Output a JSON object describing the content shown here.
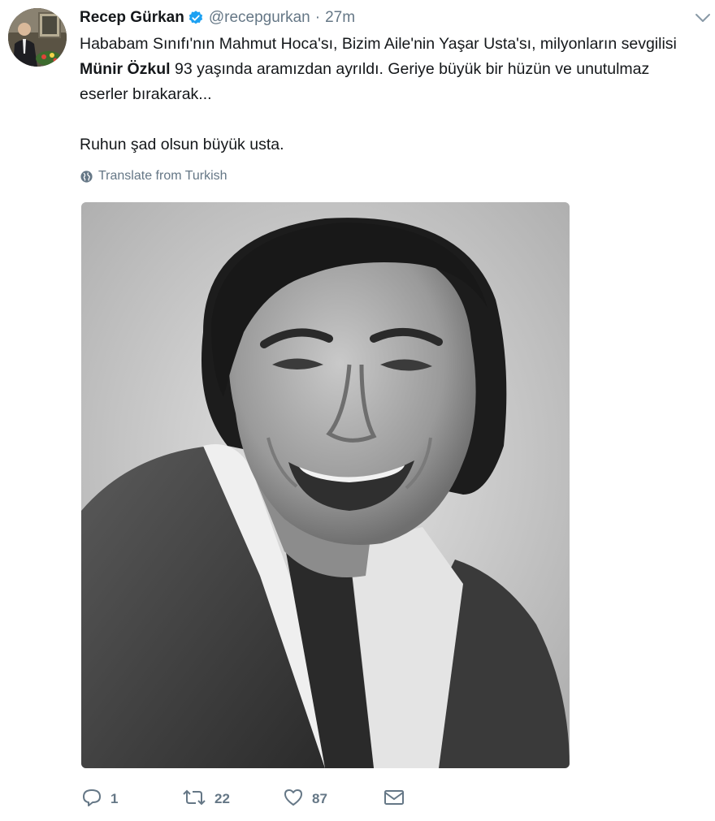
{
  "tweet": {
    "author": {
      "name": "Recep Gürkan",
      "handle": "@recepgurkan",
      "avatar_icon": "profile-photo",
      "verified_icon": "verified-badge-icon"
    },
    "separator": "·",
    "time": "27m",
    "text": {
      "p1_part1": "Hababam Sınıfı'nın Mahmut Hoca'sı, Bizim Aile'nin Yaşar Usta'sı, milyonların sevgilisi ",
      "p1_bold": "Münir Özkul",
      "p1_part2": " 93 yaşında aramızdan ayrıldı. Geriye büyük bir hüzün ve unutulmaz eserler bırakarak...",
      "p2": "Ruhun şad olsun büyük usta."
    },
    "translate_label": "Translate from Turkish",
    "media": {
      "kind": "black-and-white portrait photo of a smiling man"
    },
    "actions": {
      "reply_count": "1",
      "retweet_count": "22",
      "like_count": "87"
    }
  },
  "colors": {
    "text": "#14171a",
    "secondary": "#657786",
    "verified": "#1da1f2"
  }
}
